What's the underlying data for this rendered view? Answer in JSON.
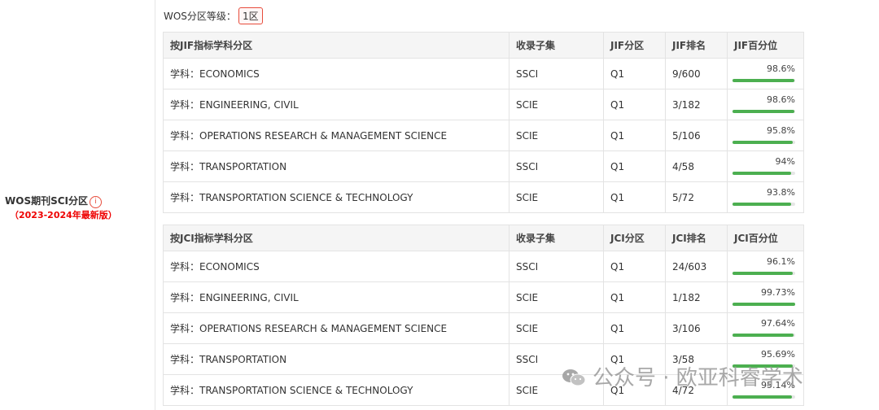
{
  "left": {
    "title": "WOS期刊SCI分区",
    "info_icon": "info-icon",
    "subtitle": "（2023-2024年最新版）"
  },
  "grade": {
    "label": "WOS分区等级：",
    "value": "1区"
  },
  "jif": {
    "headers": [
      "按JIF指标学科分区",
      "收录子集",
      "JIF分区",
      "JIF排名",
      "JIF百分位"
    ],
    "rows": [
      {
        "subject": "学科：ECONOMICS",
        "subset": "SSCI",
        "zone": "Q1",
        "rank": "9/600",
        "pct_label": "98.6%",
        "pct": 98.6
      },
      {
        "subject": "学科：ENGINEERING, CIVIL",
        "subset": "SCIE",
        "zone": "Q1",
        "rank": "3/182",
        "pct_label": "98.6%",
        "pct": 98.6
      },
      {
        "subject": "学科：OPERATIONS RESEARCH & MANAGEMENT SCIENCE",
        "subset": "SCIE",
        "zone": "Q1",
        "rank": "5/106",
        "pct_label": "95.8%",
        "pct": 95.8
      },
      {
        "subject": "学科：TRANSPORTATION",
        "subset": "SSCI",
        "zone": "Q1",
        "rank": "4/58",
        "pct_label": "94%",
        "pct": 94
      },
      {
        "subject": "学科：TRANSPORTATION SCIENCE & TECHNOLOGY",
        "subset": "SCIE",
        "zone": "Q1",
        "rank": "5/72",
        "pct_label": "93.8%",
        "pct": 93.8
      }
    ]
  },
  "jci": {
    "headers": [
      "按JCI指标学科分区",
      "收录子集",
      "JCI分区",
      "JCI排名",
      "JCI百分位"
    ],
    "rows": [
      {
        "subject": "学科：ECONOMICS",
        "subset": "SSCI",
        "zone": "Q1",
        "rank": "24/603",
        "pct_label": "96.1%",
        "pct": 96.1
      },
      {
        "subject": "学科：ENGINEERING, CIVIL",
        "subset": "SCIE",
        "zone": "Q1",
        "rank": "1/182",
        "pct_label": "99.73%",
        "pct": 99.73
      },
      {
        "subject": "学科：OPERATIONS RESEARCH & MANAGEMENT SCIENCE",
        "subset": "SCIE",
        "zone": "Q1",
        "rank": "3/106",
        "pct_label": "97.64%",
        "pct": 97.64
      },
      {
        "subject": "学科：TRANSPORTATION",
        "subset": "SSCI",
        "zone": "Q1",
        "rank": "3/58",
        "pct_label": "95.69%",
        "pct": 95.69
      },
      {
        "subject": "学科：TRANSPORTATION SCIENCE & TECHNOLOGY",
        "subset": "SCIE",
        "zone": "Q1",
        "rank": "4/72",
        "pct_label": "95.14%",
        "pct": 95.14
      }
    ]
  },
  "watermark": {
    "text": "公众号 · 欧亚科睿学术",
    "icon": "wechat-icon"
  },
  "colors": {
    "bar": "#4caf50",
    "accent": "#e74c3c",
    "highlight": "#e00000"
  }
}
